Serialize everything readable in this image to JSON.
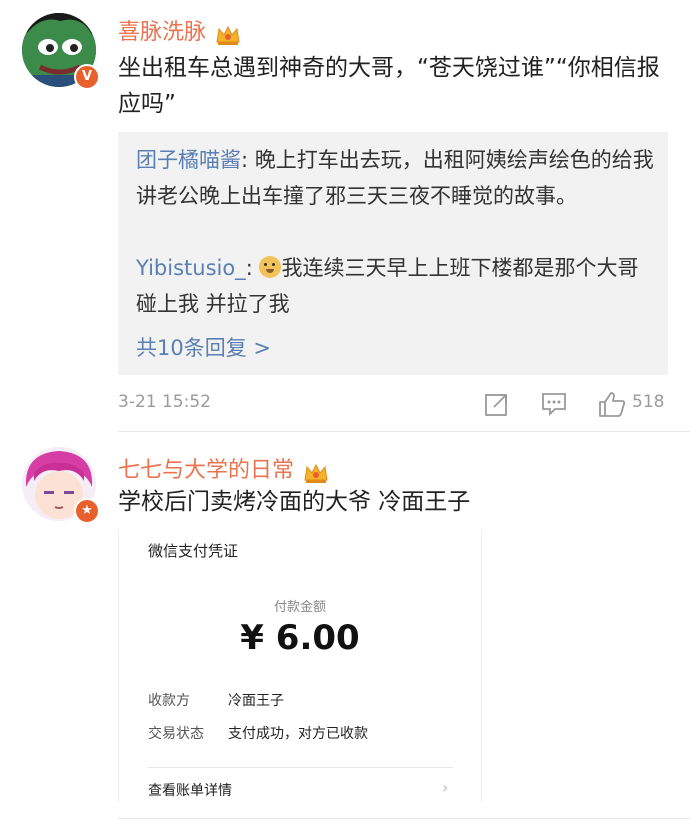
{
  "comment1": {
    "username": "喜脉洗脉",
    "text": "坐出租车总遇到神奇的大哥，“苍天饶过谁”“你相信报应吗”",
    "replies": [
      {
        "name": "团子橘喵酱",
        "text": ": 晚上打车出去玩，出租阿姨绘声绘色的给我讲老公晚上出车撞了邪三天三夜不睡觉的故事。"
      },
      {
        "name": "Yibistusio_",
        "text": ": 我连续三天早上上班下楼都是那个大哥碰上我 并拉了我"
      }
    ],
    "more_replies": "共10条回复 >",
    "time": "3-21 15:52",
    "like_count": "518",
    "badge_color": "#e8602c"
  },
  "comment2": {
    "username": "七七与大学的日常",
    "text": "学校后门卖烤冷面的大爷 冷面王子",
    "badge_color": "#e8602c"
  },
  "receipt": {
    "title": "微信支付凭证",
    "amount_label": "付款金额",
    "amount": "¥ 6.00",
    "payee_label": "收款方",
    "payee_value": "冷面王子",
    "status_label": "交易状态",
    "status_value": "支付成功，对方已收款",
    "detail_link": "查看账单详情"
  },
  "icons": {
    "crown": "crown-icon",
    "verified": "verified-badge-icon",
    "emoji": "doge-emoji-icon",
    "share": "share-icon",
    "comment": "comment-icon",
    "like": "thumbs-up-icon",
    "chevron": "chevron-right-icon"
  }
}
